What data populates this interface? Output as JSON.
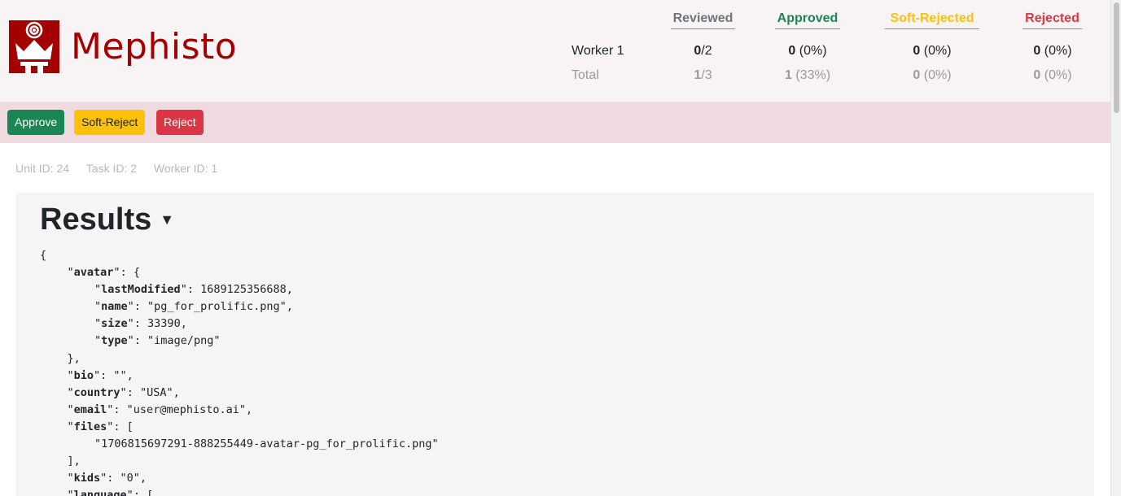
{
  "brand": {
    "name": "Mephisto",
    "color": "#a50000",
    "icon": "crown-broadcast-icon"
  },
  "stats": {
    "headers": {
      "reviewed": "Reviewed",
      "approved": "Approved",
      "soft_rejected": "Soft-Rejected",
      "rejected": "Rejected"
    },
    "header_colors": {
      "reviewed": "#6c757d",
      "approved": "#198754",
      "soft_rejected": "#ffc107",
      "rejected": "#dc3545"
    },
    "rows": [
      {
        "label": "Worker 1",
        "reviewed_count": "0",
        "reviewed_total": "/2",
        "approved_count": "0",
        "approved_pct": " (0%)",
        "soft_rejected_count": "0",
        "soft_rejected_pct": " (0%)",
        "rejected_count": "0",
        "rejected_pct": " (0%)"
      },
      {
        "label": "Total",
        "reviewed_count": "1",
        "reviewed_total": "/3",
        "approved_count": "1",
        "approved_pct": " (33%)",
        "soft_rejected_count": "0",
        "soft_rejected_pct": " (0%)",
        "rejected_count": "0",
        "rejected_pct": " (0%)"
      }
    ]
  },
  "toolbar": {
    "approve_label": "Approve",
    "soft_reject_label": "Soft-Reject",
    "reject_label": "Reject"
  },
  "ids": {
    "unit": "Unit ID: 24",
    "task": "Task ID: 2",
    "worker": "Worker ID: 1"
  },
  "results": {
    "title": "Results",
    "caret": "▼",
    "lines": [
      {
        "indent": 0,
        "key": "",
        "value": "{"
      },
      {
        "indent": 1,
        "key": "avatar",
        "value": ": {"
      },
      {
        "indent": 2,
        "key": "lastModified",
        "value": ": 1689125356688,"
      },
      {
        "indent": 2,
        "key": "name",
        "value": ": \"pg_for_prolific.png\","
      },
      {
        "indent": 2,
        "key": "size",
        "value": ": 33390,"
      },
      {
        "indent": 2,
        "key": "type",
        "value": ": \"image/png\""
      },
      {
        "indent": 1,
        "key": "",
        "value": "},"
      },
      {
        "indent": 1,
        "key": "bio",
        "value": ": \"\","
      },
      {
        "indent": 1,
        "key": "country",
        "value": ": \"USA\","
      },
      {
        "indent": 1,
        "key": "email",
        "value": ": \"user@mephisto.ai\","
      },
      {
        "indent": 1,
        "key": "files",
        "value": ": ["
      },
      {
        "indent": 2,
        "key": "",
        "value": "\"1706815697291-888255449-avatar-pg_for_prolific.png\""
      },
      {
        "indent": 1,
        "key": "",
        "value": "],"
      },
      {
        "indent": 1,
        "key": "kids",
        "value": ": \"0\","
      },
      {
        "indent": 1,
        "key": "language",
        "value": ": ["
      }
    ]
  }
}
